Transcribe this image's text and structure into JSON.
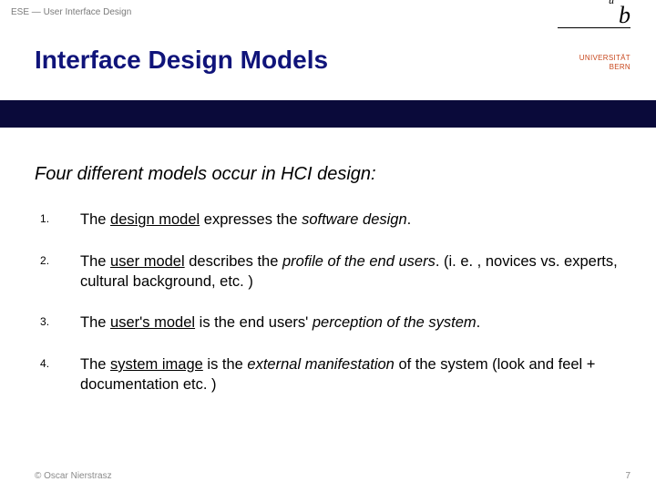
{
  "breadcrumb": "ESE — User Interface Design",
  "title": "Interface Design Models",
  "logo": {
    "sup": "u",
    "letter": "b",
    "uni_line1": "UNIVERSITÄT",
    "uni_line2": "BERN"
  },
  "subtitle": "Four different models occur in HCI design:",
  "items": [
    {
      "pre": "The ",
      "term": "design model",
      "mid": " expresses the ",
      "emph": "software design",
      "post": "."
    },
    {
      "pre": "The ",
      "term": "user model",
      "mid": " describes the ",
      "emph": "profile of the end users",
      "post": ". (i. e. , novices vs. experts, cultural background, etc. )"
    },
    {
      "pre": "The ",
      "term": "user's model",
      "mid": " is the end users' ",
      "emph": "perception of the system",
      "post": "."
    },
    {
      "pre": "The ",
      "term": "system image",
      "mid": " is the ",
      "emph": "external manifestation",
      "post": " of the system (look and feel + documentation etc. )"
    }
  ],
  "footer": {
    "copyright": "© Oscar Nierstrasz",
    "page": "7"
  }
}
